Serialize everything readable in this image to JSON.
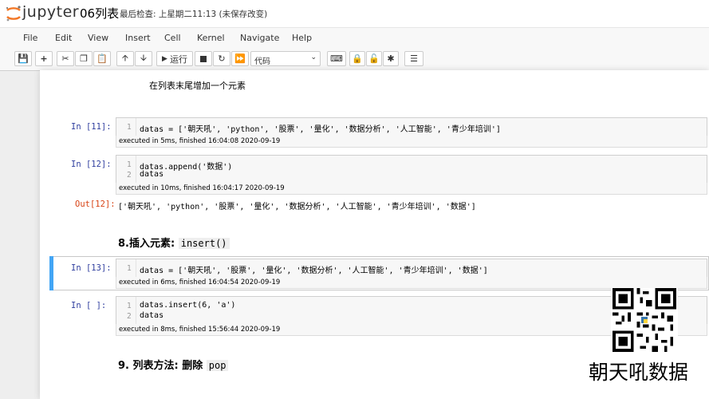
{
  "header": {
    "logo_text": "jupyter",
    "notebook_title": "06列表",
    "checkpoint": "最后检查: 上星期二11:13  (未保存改变)"
  },
  "menu": [
    "File",
    "Edit",
    "View",
    "Insert",
    "Cell",
    "Kernel",
    "Navigate",
    "Help"
  ],
  "toolbar": {
    "run_label": "运行",
    "cell_type": "代码",
    "icons": [
      "save-icon",
      "add-icon",
      "cut-icon",
      "copy-icon",
      "paste-icon",
      "move-up-icon",
      "move-down-icon",
      "run-icon",
      "stop-icon",
      "restart-icon",
      "fast-forward-icon",
      "keyboard-icon",
      "lock-icon",
      "unlock-icon",
      "asterisk-icon",
      "list-icon"
    ]
  },
  "notebook": {
    "md_top": "在列表末尾增加一个元素",
    "cells": [
      {
        "prompt": "In [11]:",
        "lines": [
          {
            "n": "1",
            "text": "datas = ['朝天吼', 'python', '股票', '量化', '数据分析', '人工智能', '青少年培训']"
          }
        ],
        "exec": "executed in 5ms, finished 16:04:08 2020-09-19"
      },
      {
        "prompt": "In [12]:",
        "lines": [
          {
            "n": "1",
            "text": "datas.append('数据')"
          },
          {
            "n": "2",
            "text": "datas"
          }
        ],
        "exec": "executed in 10ms, finished 16:04:17 2020-09-19",
        "out_prompt": "Out[12]:",
        "output": "['朝天吼', 'python', '股票', '量化', '数据分析', '人工智能', '青少年培训', '数据']"
      },
      {
        "prompt": "In [13]:",
        "lines": [
          {
            "n": "1",
            "text": "datas = ['朝天吼', '股票', '量化', '数据分析', '人工智能', '青少年培训', '数据']"
          }
        ],
        "exec": "executed in 6ms, finished 16:04:54 2020-09-19"
      },
      {
        "prompt": "In [ ]:",
        "lines": [
          {
            "n": "1",
            "text": "datas.insert(6, 'a')"
          },
          {
            "n": "2",
            "text": "datas"
          }
        ],
        "exec": "executed in 8ms, finished 15:56:44 2020-09-19"
      }
    ],
    "heading8_text": "8.插入元素: ",
    "heading8_code": "insert()",
    "heading9_text": "9. 列表方法: 删除",
    "heading9_code": "pop"
  },
  "watermark": {
    "brand": "朝天吼数据"
  }
}
